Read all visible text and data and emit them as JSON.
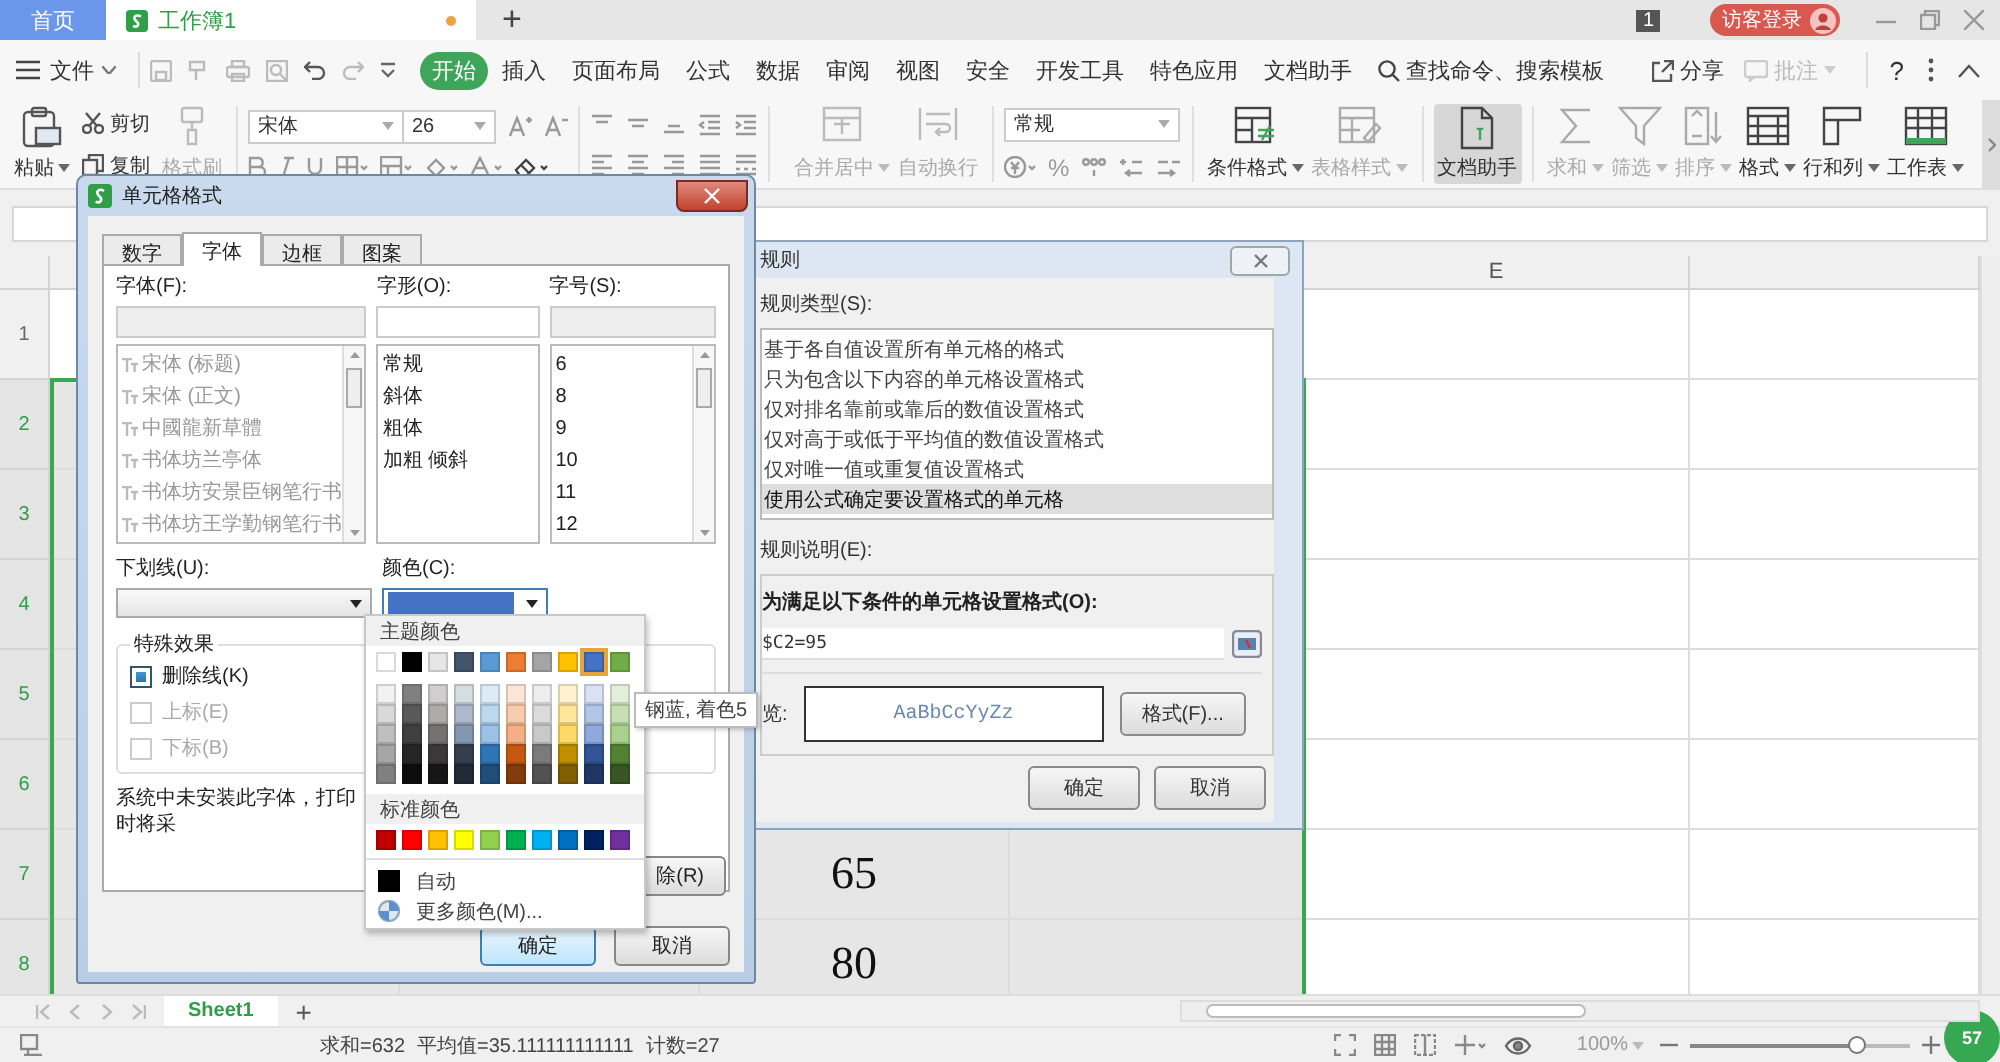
{
  "tabs": [
    {
      "kind": "home",
      "label": "首页",
      "selected": false
    },
    {
      "kind": "doc",
      "label": "工作簿1",
      "selected": true,
      "unsaved": true
    }
  ],
  "new_tab": "+",
  "title_bar": {
    "window_count": "1",
    "login": "访客登录"
  },
  "menu": {
    "file": "文件",
    "tabs": [
      {
        "label": "开始",
        "selected": true
      },
      {
        "label": "插入",
        "selected": false
      },
      {
        "label": "页面布局",
        "selected": false
      },
      {
        "label": "公式",
        "selected": false
      },
      {
        "label": "数据",
        "selected": false
      },
      {
        "label": "审阅",
        "selected": false
      },
      {
        "label": "视图",
        "selected": false
      },
      {
        "label": "安全",
        "selected": false
      },
      {
        "label": "开发工具",
        "selected": false
      },
      {
        "label": "特色应用",
        "selected": false
      },
      {
        "label": "文档助手",
        "selected": false
      }
    ],
    "search": "查找命令、搜索模板",
    "share": "分享",
    "comment": {
      "label": "批注",
      "disabled": true
    },
    "help": "?"
  },
  "ribbon": {
    "paste": "粘贴",
    "cut": "剪切",
    "copy": "复制",
    "format_painter": {
      "label": "格式刷",
      "disabled": true
    },
    "font_name": "宋体",
    "font_size": "26",
    "merge": {
      "label": "合并居中",
      "disabled": true
    },
    "wrap": {
      "label": "自动换行",
      "disabled": true
    },
    "number_format": "常规",
    "percent": "%",
    "tools": [
      {
        "kind": "conditional",
        "label": "条件格式",
        "disabled": false,
        "pressed": false,
        "dropdown": true
      },
      {
        "kind": "table-style",
        "label": "表格样式",
        "disabled": true,
        "pressed": false,
        "dropdown": true
      },
      {
        "kind": "assistant",
        "label": "文档助手",
        "disabled": false,
        "pressed": true,
        "dropdown": false
      },
      {
        "kind": "sum",
        "label": "求和",
        "disabled": true,
        "pressed": false,
        "dropdown": true
      },
      {
        "kind": "filter",
        "label": "筛选",
        "disabled": true,
        "pressed": false,
        "dropdown": true
      },
      {
        "kind": "sort",
        "label": "排序",
        "disabled": true,
        "pressed": false,
        "dropdown": true
      },
      {
        "kind": "format",
        "label": "格式",
        "disabled": false,
        "pressed": false,
        "dropdown": true
      },
      {
        "kind": "rows-cols",
        "label": "行和列",
        "disabled": false,
        "pressed": false,
        "dropdown": true
      },
      {
        "kind": "worksheet",
        "label": "工作表",
        "disabled": false,
        "pressed": false,
        "dropdown": true
      }
    ]
  },
  "sheet": {
    "column_5": "E",
    "rows": [
      {
        "label": "1",
        "selected": false
      },
      {
        "label": "2",
        "selected": true
      },
      {
        "label": "3",
        "selected": true
      },
      {
        "label": "4",
        "selected": true
      },
      {
        "label": "5",
        "selected": true
      },
      {
        "label": "6",
        "selected": true
      },
      {
        "label": "7",
        "selected": true,
        "column_3": "65"
      },
      {
        "label": "8",
        "selected": true,
        "column_3": "80"
      }
    ]
  },
  "sheet_tabs": {
    "tabs": [
      {
        "label": "Sheet1",
        "selected": true
      }
    ],
    "add": "+"
  },
  "status_bar": {
    "sum": "求和=632",
    "average": "平均值=35.111111111111",
    "count": "计数=27",
    "zoom": "100%",
    "zoom_slider": {
      "level": 0.75
    },
    "notifications": "57"
  },
  "rule_dialog": {
    "title": "规则",
    "type_label": "规则类型(S):",
    "types": [
      {
        "label": "基于各自值设置所有单元格的格式",
        "selected": false
      },
      {
        "label": "只为包含以下内容的单元格设置格式",
        "selected": false
      },
      {
        "label": "仅对排名靠前或靠后的数值设置格式",
        "selected": false
      },
      {
        "label": "仅对高于或低于平均值的数值设置格式",
        "selected": false
      },
      {
        "label": "仅对唯一值或重复值设置格式",
        "selected": false
      },
      {
        "label": "使用公式确定要设置格式的单元格",
        "selected": true
      }
    ],
    "description_label": "规则说明(E):",
    "condition_label": "为满足以下条件的单元格设置格式(O):",
    "formula": "$C2=95",
    "preview_label": "览:",
    "preview_text": "AaBbCcYyZz",
    "format_button": "格式(F)...",
    "buttons": [
      "确定",
      "取消"
    ]
  },
  "format_dialog": {
    "title": "单元格格式",
    "tabs": [
      {
        "label": "数字",
        "selected": false
      },
      {
        "label": "字体",
        "selected": true
      },
      {
        "label": "边框",
        "selected": false
      },
      {
        "label": "图案",
        "selected": false
      }
    ],
    "font_label": "字体(F):",
    "fonts": [
      {
        "label": "宋体 (标题)",
        "available": false
      },
      {
        "label": "宋体 (正文)",
        "available": false
      },
      {
        "label": "中國龍新草體",
        "available": false
      },
      {
        "label": "书体坊兰亭体",
        "available": false
      },
      {
        "label": "书体坊安景臣钢笔行书",
        "available": false
      },
      {
        "label": "书体坊王学勤钢笔行书",
        "available": false
      }
    ],
    "style_label": "字形(O):",
    "styles": [
      "常规",
      "斜体",
      "粗体",
      "加粗 倾斜"
    ],
    "size_label": "字号(S):",
    "sizes": [
      "6",
      "8",
      "9",
      "10",
      "11",
      "12"
    ],
    "underline_label": "下划线(U):",
    "color_label": "颜色(C):",
    "color": "#4472c4",
    "effects_title": "特殊效果",
    "effects": [
      {
        "label": "删除线(K)",
        "checked": true,
        "disabled": false
      },
      {
        "label": "上标(E)",
        "checked": false,
        "disabled": true
      },
      {
        "label": "下标(B)",
        "checked": false,
        "disabled": true
      }
    ],
    "note": "系统中未安装此字体，打印时将采",
    "clear_button": "除(R)",
    "buttons": [
      "确定",
      "取消"
    ]
  },
  "color_popup": {
    "theme_title": "主题颜色",
    "theme": [
      {
        "color": "#ffffff",
        "selected": false
      },
      {
        "color": "#000000",
        "selected": false
      },
      {
        "color": "#e7e6e6",
        "selected": false
      },
      {
        "color": "#44546a",
        "selected": false
      },
      {
        "color": "#5b9bd5",
        "selected": false
      },
      {
        "color": "#ed7d31",
        "selected": false
      },
      {
        "color": "#a5a5a5",
        "selected": false
      },
      {
        "color": "#ffc000",
        "selected": false
      },
      {
        "color": "#4472c4",
        "selected": true
      },
      {
        "color": "#70ad47",
        "selected": false
      }
    ],
    "shades": [
      [
        {
          "color": "#f2f2f2"
        },
        {
          "color": "#808080"
        },
        {
          "color": "#d0cece"
        },
        {
          "color": "#d6dce4"
        },
        {
          "color": "#ddebf7"
        },
        {
          "color": "#fce4d6"
        },
        {
          "color": "#ededed"
        },
        {
          "color": "#fff2cc"
        },
        {
          "color": "#d9e1f2"
        },
        {
          "color": "#e2efda"
        }
      ],
      [
        {
          "color": "#d9d9d9"
        },
        {
          "color": "#595959"
        },
        {
          "color": "#aeabab"
        },
        {
          "color": "#adb9ca"
        },
        {
          "color": "#bdd7ee"
        },
        {
          "color": "#f8cbad"
        },
        {
          "color": "#dbdbdb"
        },
        {
          "color": "#ffe699"
        },
        {
          "color": "#b4c6e7"
        },
        {
          "color": "#c6e0b4"
        }
      ],
      [
        {
          "color": "#bfbfbf"
        },
        {
          "color": "#404040"
        },
        {
          "color": "#757171"
        },
        {
          "color": "#8497b0"
        },
        {
          "color": "#9bc2e6"
        },
        {
          "color": "#f4b084"
        },
        {
          "color": "#c9c9c9"
        },
        {
          "color": "#ffd966"
        },
        {
          "color": "#8ea9db"
        },
        {
          "color": "#a9d08e"
        }
      ],
      [
        {
          "color": "#a6a6a6"
        },
        {
          "color": "#262626"
        },
        {
          "color": "#3a3838"
        },
        {
          "color": "#333f4f"
        },
        {
          "color": "#2f75b5"
        },
        {
          "color": "#c65911"
        },
        {
          "color": "#7b7b7b"
        },
        {
          "color": "#bf8f00"
        },
        {
          "color": "#305496"
        },
        {
          "color": "#548235"
        }
      ],
      [
        {
          "color": "#808080"
        },
        {
          "color": "#0d0d0d"
        },
        {
          "color": "#171616"
        },
        {
          "color": "#222a35"
        },
        {
          "color": "#1f4e78"
        },
        {
          "color": "#833c0c"
        },
        {
          "color": "#525252"
        },
        {
          "color": "#806000"
        },
        {
          "color": "#203764"
        },
        {
          "color": "#375623"
        }
      ]
    ],
    "tooltip": "钢蓝, 着色5",
    "standard_title": "标准颜色",
    "standard": [
      {
        "color": "#c00000"
      },
      {
        "color": "#ff0000"
      },
      {
        "color": "#ffc000"
      },
      {
        "color": "#ffff00"
      },
      {
        "color": "#92d050"
      },
      {
        "color": "#00b050"
      },
      {
        "color": "#00b0f0"
      },
      {
        "color": "#0070c0"
      },
      {
        "color": "#002060"
      },
      {
        "color": "#7030a0"
      }
    ],
    "auto": {
      "label": "自动",
      "color": "#000000"
    },
    "more": "更多颜色(M)..."
  }
}
